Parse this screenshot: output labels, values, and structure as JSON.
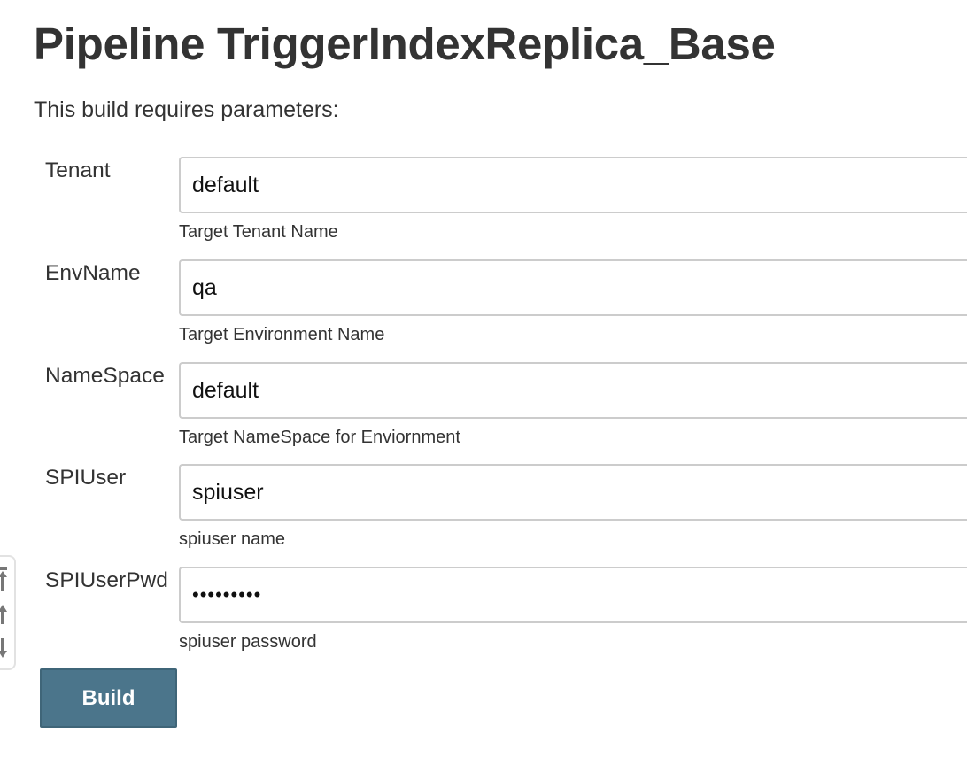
{
  "page": {
    "title": "Pipeline TriggerIndexReplica_Base",
    "subtitle": "This build requires parameters:"
  },
  "params": [
    {
      "label": "Tenant",
      "value": "default",
      "description": "Target Tenant Name"
    },
    {
      "label": "EnvName",
      "value": "qa",
      "description": "Target Environment Name"
    },
    {
      "label": "NameSpace",
      "value": "default",
      "description": "Target NameSpace for Enviornment"
    },
    {
      "label": "SPIUser",
      "value": "spiuser",
      "description": "spiuser name"
    },
    {
      "label": "SPIUserPwd",
      "value": "•••••••••",
      "description": "spiuser password"
    }
  ],
  "side_widget": {
    "icons": [
      "scroll-to-top-icon",
      "scroll-up-icon",
      "scroll-down-icon"
    ]
  },
  "actions": {
    "build_label": "Build"
  },
  "colors": {
    "text": "#333333",
    "button_bg": "#4b758b",
    "input_border": "#cccccc"
  }
}
